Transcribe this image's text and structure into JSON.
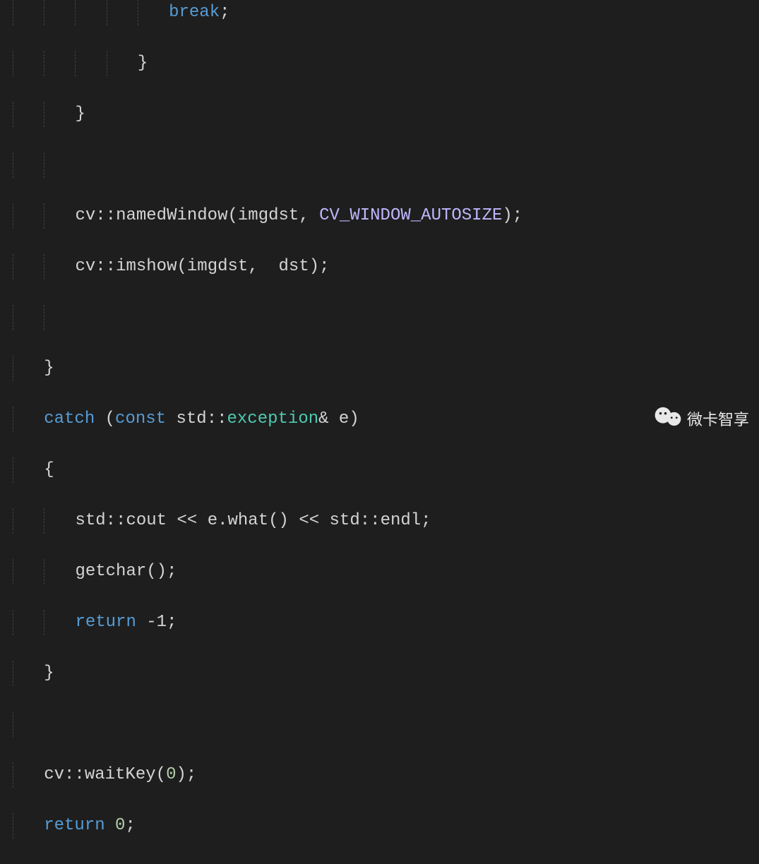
{
  "code": {
    "break_kw": "break",
    "semi": ";",
    "brace_close": "}",
    "brace_open": "{",
    "cv_ns": "cv",
    "dbl_colon": "::",
    "namedWindow": "namedWindow",
    "imshow": "imshow",
    "lparen": "(",
    "rparen": ")",
    "imgdst": "imgdst",
    "comma_sp": ", ",
    "comma_sp2": ",  ",
    "autosize": "CV_WINDOW_AUTOSIZE",
    "dst": "dst",
    "catch_kw": "catch",
    "sp_lp": " (",
    "const_kw": "const",
    "space": " ",
    "std": "std",
    "exception": "exception",
    "amp_e": "& e",
    "cout": "cout",
    "ins": " << ",
    "ewhat": "e.what",
    "endl": "endl",
    "getchar": "getchar",
    "return_kw": "return",
    "neg1": " -1",
    "waitKey": "waitKey",
    "zero_arg": "0",
    "sp_zero": " 0"
  },
  "watermark": {
    "text": "微卡智享"
  }
}
